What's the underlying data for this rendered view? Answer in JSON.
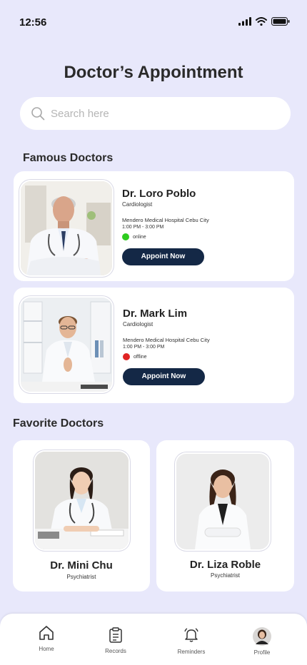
{
  "status": {
    "time": "12:56"
  },
  "title": "Doctor’s Appointment",
  "search": {
    "placeholder": "Search here",
    "value": ""
  },
  "famous": {
    "heading": "Famous Doctors",
    "doctors": [
      {
        "name": "Dr. Loro Poblo",
        "specialty": "Cardiologist",
        "hospital": "Mendero Medical Hospital Cebu City",
        "hours": "1:00 PM - 3:00 PM",
        "status": "online",
        "status_color": "#2ecc1f",
        "button": "Appoint Now"
      },
      {
        "name": "Dr. Mark Lim",
        "specialty": "Cardiologist",
        "hospital": "Mendero Medical Hospital Cebu City",
        "hours": "1:00 PM - 3:00 PM",
        "status": "offline",
        "status_color": "#e02424",
        "button": "Appoint Now"
      }
    ]
  },
  "favorite": {
    "heading": "Favorite Doctors",
    "doctors": [
      {
        "name": "Dr. Mini Chu",
        "specialty": "Psychiatrist"
      },
      {
        "name": "Dr. Liza Roble",
        "specialty": "Psychiatrist"
      }
    ]
  },
  "tabs": [
    {
      "label": "Home",
      "icon": "home-icon"
    },
    {
      "label": "Records",
      "icon": "records-icon"
    },
    {
      "label": "Reminders",
      "icon": "bell-icon"
    },
    {
      "label": "Profile",
      "icon": "avatar"
    }
  ],
  "colors": {
    "background": "#e8e8fb",
    "button": "#142846",
    "online": "#2ecc1f",
    "offline": "#e02424"
  }
}
